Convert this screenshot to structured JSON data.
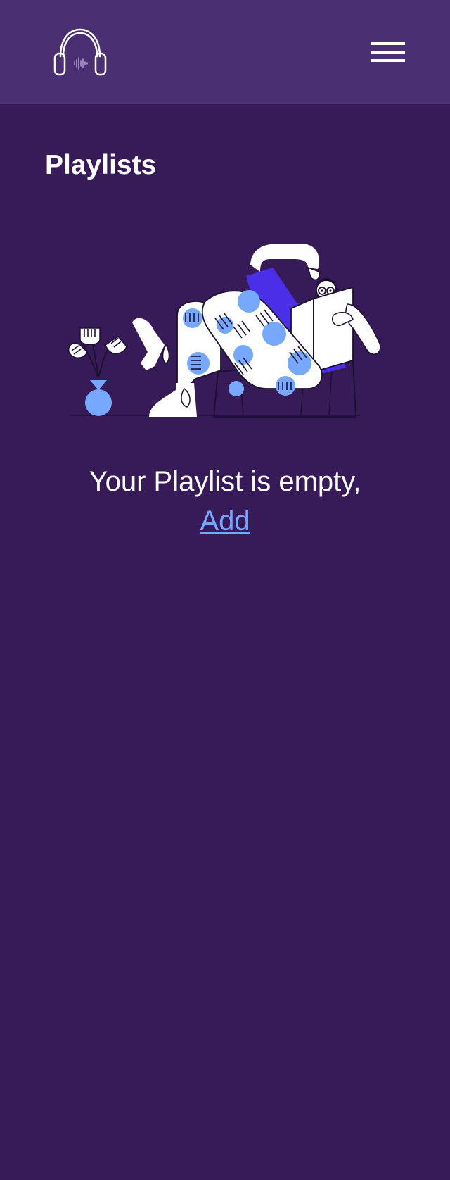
{
  "header": {
    "logo_icon": "headphones-icon",
    "menu_icon": "hamburger-menu-icon"
  },
  "page": {
    "title": "Playlists"
  },
  "empty_state": {
    "illustration": "person-reading-newspaper-illustration",
    "message": "Your Playlist is empty,",
    "add_link": "Add"
  },
  "colors": {
    "background": "#371b58",
    "header": "#4a2f72",
    "accent": "#77a8ff",
    "text": "#ffffff",
    "illustration_purple": "#4b2ee8"
  }
}
